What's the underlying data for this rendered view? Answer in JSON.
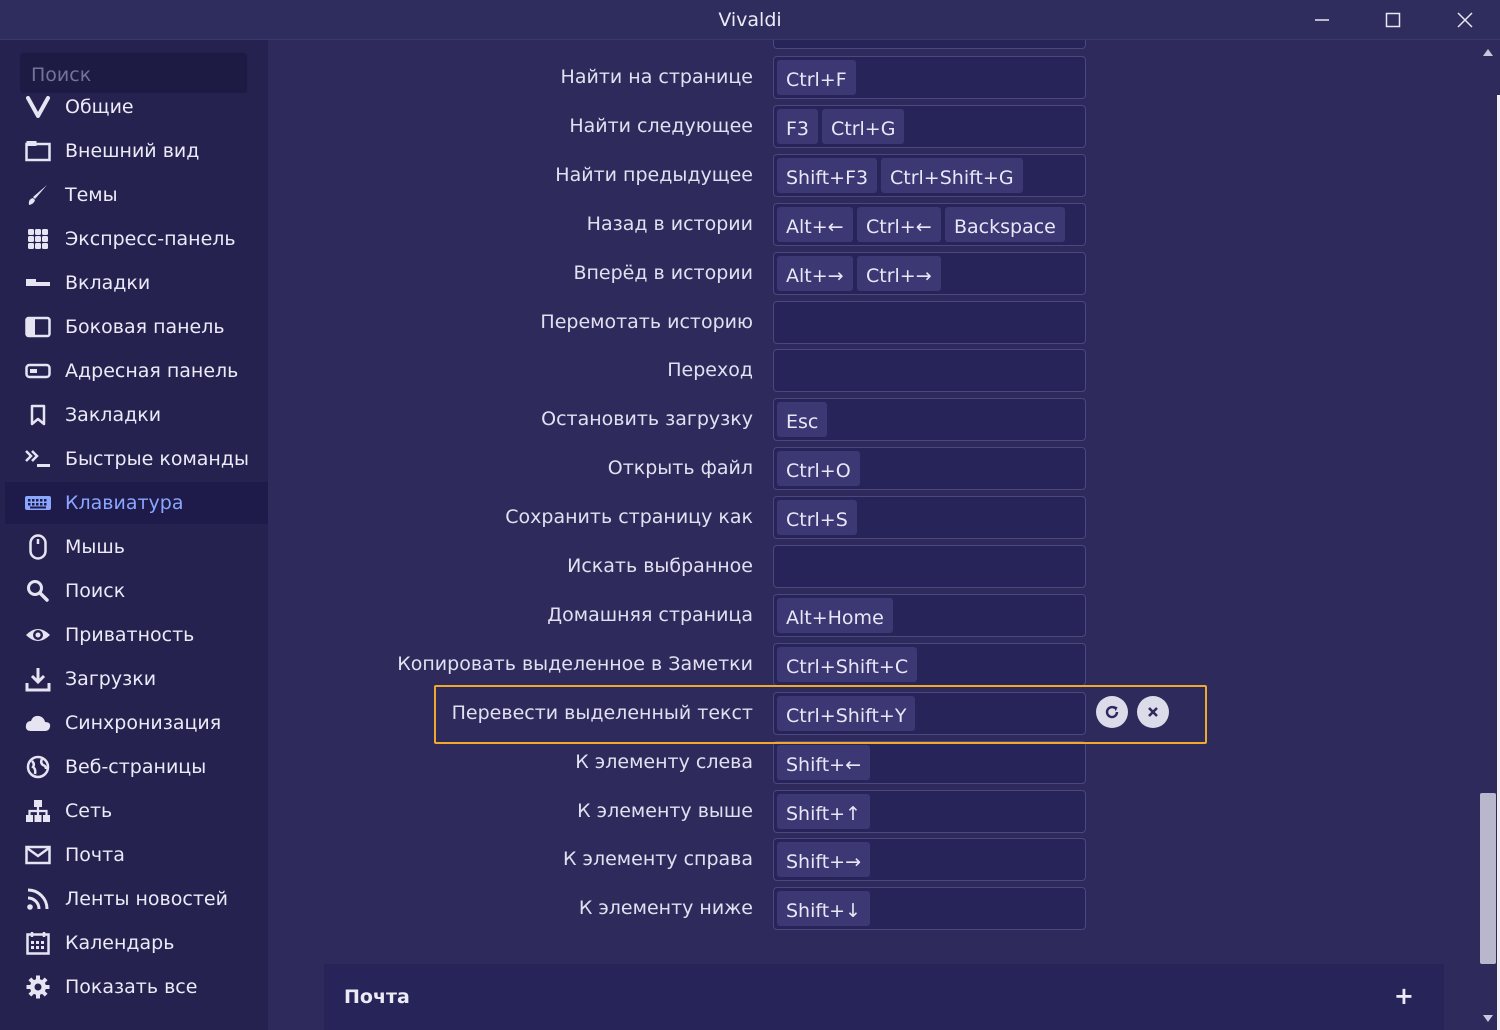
{
  "window": {
    "title": "Vivaldi"
  },
  "sidebar": {
    "search_placeholder": "Поиск",
    "items": [
      {
        "label": "Общие",
        "icon": "vivaldi-logo-icon"
      },
      {
        "label": "Внешний вид",
        "icon": "window-icon"
      },
      {
        "label": "Темы",
        "icon": "brush-icon"
      },
      {
        "label": "Экспресс-панель",
        "icon": "grid-icon"
      },
      {
        "label": "Вкладки",
        "icon": "tabs-icon"
      },
      {
        "label": "Боковая панель",
        "icon": "side-panel-icon"
      },
      {
        "label": "Адресная панель",
        "icon": "address-bar-icon"
      },
      {
        "label": "Закладки",
        "icon": "bookmark-icon"
      },
      {
        "label": "Быстрые команды",
        "icon": "quick-commands-icon"
      },
      {
        "label": "Клавиатура",
        "icon": "keyboard-icon",
        "active": true
      },
      {
        "label": "Мышь",
        "icon": "mouse-icon"
      },
      {
        "label": "Поиск",
        "icon": "search-icon"
      },
      {
        "label": "Приватность",
        "icon": "eye-icon"
      },
      {
        "label": "Загрузки",
        "icon": "download-icon"
      },
      {
        "label": "Синхронизация",
        "icon": "cloud-icon"
      },
      {
        "label": "Веб-страницы",
        "icon": "globe-icon"
      },
      {
        "label": "Сеть",
        "icon": "network-icon"
      },
      {
        "label": "Почта",
        "icon": "mail-icon"
      },
      {
        "label": "Ленты новостей",
        "icon": "rss-icon"
      },
      {
        "label": "Календарь",
        "icon": "calendar-icon"
      },
      {
        "label": "Показать все",
        "icon": "gear-icon"
      }
    ]
  },
  "shortcuts": [
    {
      "label": "Найти на странице",
      "keys": [
        "Ctrl+F"
      ]
    },
    {
      "label": "Найти следующее",
      "keys": [
        "F3",
        "Ctrl+G"
      ]
    },
    {
      "label": "Найти предыдущее",
      "keys": [
        "Shift+F3",
        "Ctrl+Shift+G"
      ]
    },
    {
      "label": "Назад в истории",
      "keys": [
        "Alt+←",
        "Ctrl+←",
        "Backspace"
      ]
    },
    {
      "label": "Вперёд в истории",
      "keys": [
        "Alt+→",
        "Ctrl+→"
      ]
    },
    {
      "label": "Перемотать историю",
      "keys": []
    },
    {
      "label": "Переход",
      "keys": []
    },
    {
      "label": "Остановить загрузку",
      "keys": [
        "Esc"
      ]
    },
    {
      "label": "Открыть файл",
      "keys": [
        "Ctrl+O"
      ]
    },
    {
      "label": "Сохранить страницу как",
      "keys": [
        "Ctrl+S"
      ]
    },
    {
      "label": "Искать выбранное",
      "keys": []
    },
    {
      "label": "Домашняя страница",
      "keys": [
        "Alt+Home"
      ]
    },
    {
      "label": "Копировать выделенное в Заметки",
      "keys": [
        "Ctrl+Shift+C"
      ]
    },
    {
      "label": "Перевести выделенный текст",
      "keys": [
        "Ctrl+Shift+Y"
      ],
      "highlighted": true
    },
    {
      "label": "К элементу слева",
      "keys": [
        "Shift+←"
      ]
    },
    {
      "label": "К элементу выше",
      "keys": [
        "Shift+↑"
      ]
    },
    {
      "label": "К элементу справа",
      "keys": [
        "Shift+→"
      ]
    },
    {
      "label": "К элементу ниже",
      "keys": [
        "Shift+↓"
      ]
    }
  ],
  "section": {
    "title": "Почта",
    "expand_symbol": "+"
  },
  "colors": {
    "highlight": "#f0a92a",
    "active_nav": "#8aa6ff"
  }
}
